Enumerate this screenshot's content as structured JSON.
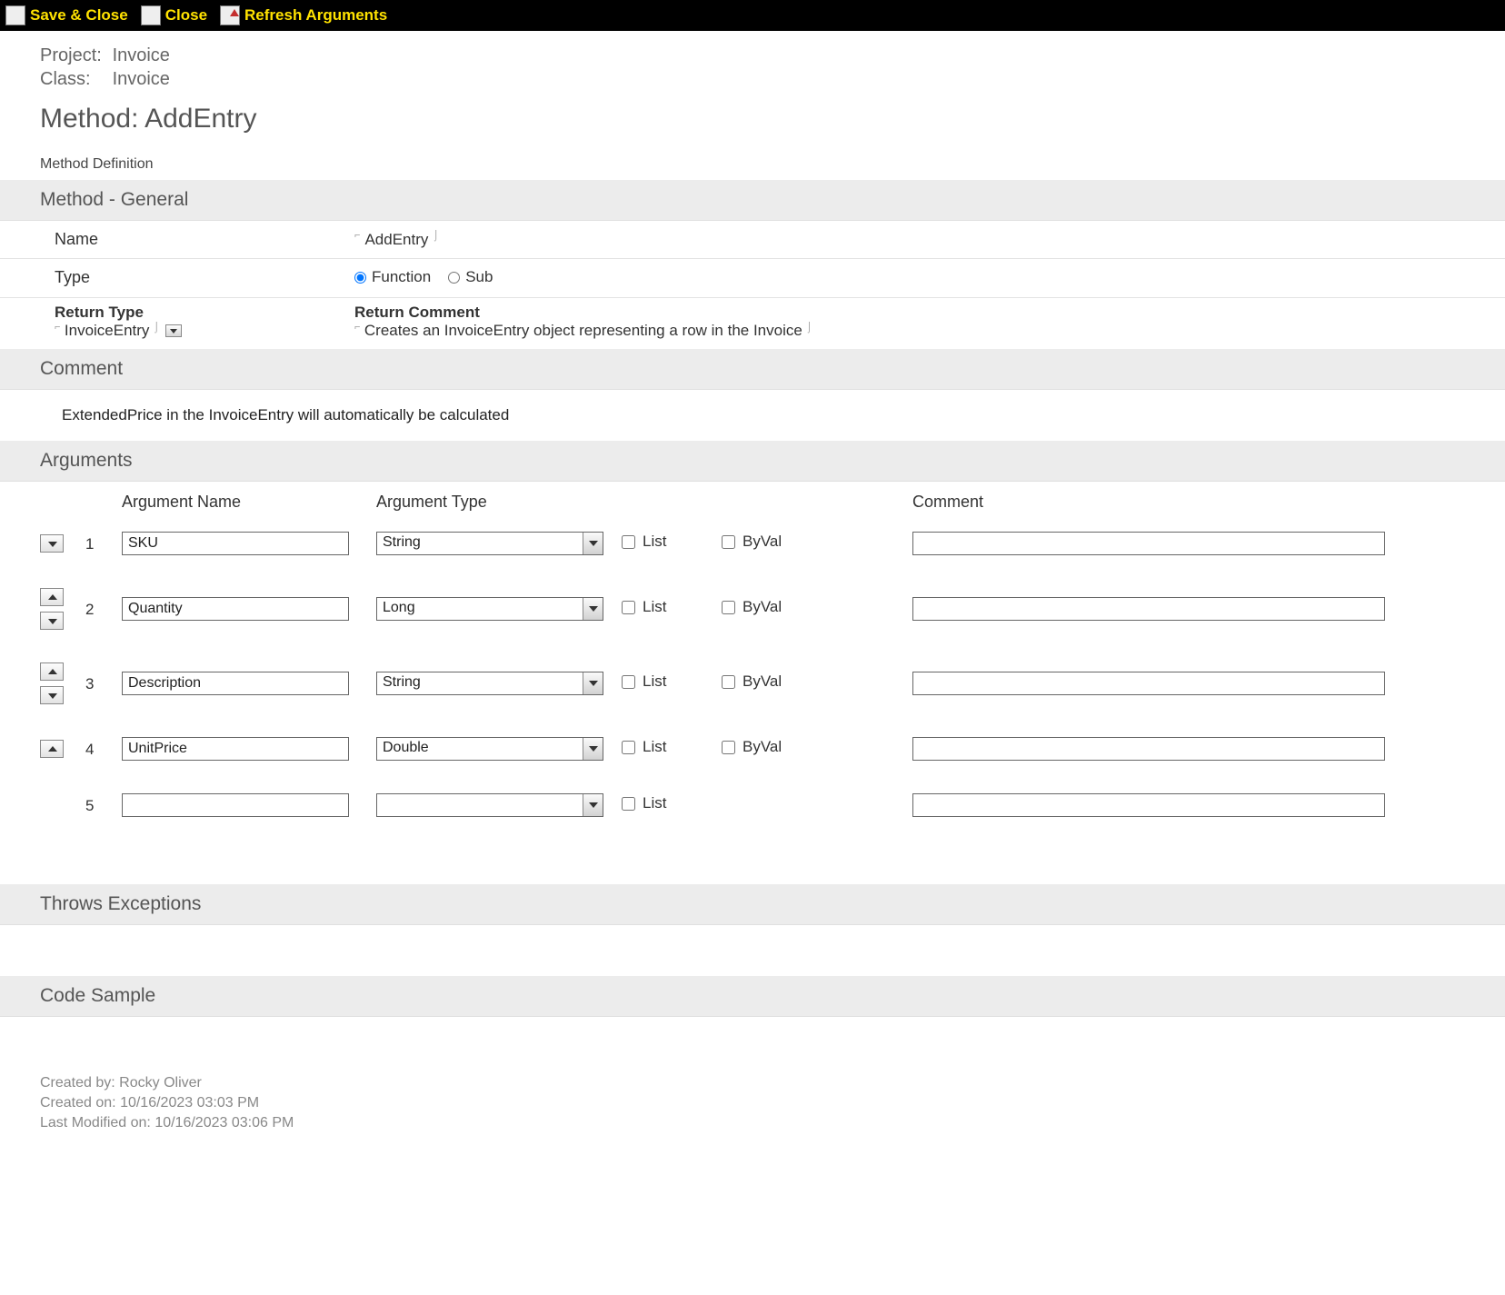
{
  "toolbar": {
    "save_close": "Save & Close",
    "close": "Close",
    "refresh": "Refresh Arguments"
  },
  "header": {
    "project_label": "Project:",
    "project_value": "Invoice",
    "class_label": "Class:",
    "class_value": "Invoice",
    "method_title_prefix": "Method: ",
    "method_title_name": "AddEntry",
    "method_definition": "Method Definition"
  },
  "sections": {
    "method_general": "Method - General",
    "comment": "Comment",
    "arguments": "Arguments",
    "throws": "Throws Exceptions",
    "code_sample": "Code Sample"
  },
  "general": {
    "name_label": "Name",
    "name_value": "AddEntry",
    "type_label": "Type",
    "type_function": "Function",
    "type_sub": "Sub",
    "type_selected": "Function",
    "return_type_label": "Return Type",
    "return_type_value": "InvoiceEntry",
    "return_comment_label": "Return Comment",
    "return_comment_value": "Creates an InvoiceEntry object representing a row in the Invoice"
  },
  "comment_text": "ExtendedPrice in the InvoiceEntry will automatically be calculated",
  "args_header": {
    "name": "Argument Name",
    "type": "Argument Type",
    "list": "List",
    "byval": "ByVal",
    "comment": "Comment"
  },
  "arguments": [
    {
      "num": "1",
      "name": "SKU",
      "type": "String",
      "list": false,
      "byval": false,
      "comment": "",
      "can_up": false,
      "can_down": true
    },
    {
      "num": "2",
      "name": "Quantity",
      "type": "Long",
      "list": false,
      "byval": false,
      "comment": "",
      "can_up": true,
      "can_down": true
    },
    {
      "num": "3",
      "name": "Description",
      "type": "String",
      "list": false,
      "byval": false,
      "comment": "",
      "can_up": true,
      "can_down": true
    },
    {
      "num": "4",
      "name": "UnitPrice",
      "type": "Double",
      "list": false,
      "byval": false,
      "comment": "",
      "can_up": true,
      "can_down": false
    },
    {
      "num": "5",
      "name": "",
      "type": "",
      "list": false,
      "byval": null,
      "comment": "",
      "can_up": false,
      "can_down": false
    }
  ],
  "footer": {
    "created_by_label": "Created by:",
    "created_by_value": "Rocky Oliver",
    "created_on_label": "Created on:",
    "created_on_value": "10/16/2023 03:03 PM",
    "modified_on_label": "Last Modified on:",
    "modified_on_value": "10/16/2023 03:06 PM"
  }
}
